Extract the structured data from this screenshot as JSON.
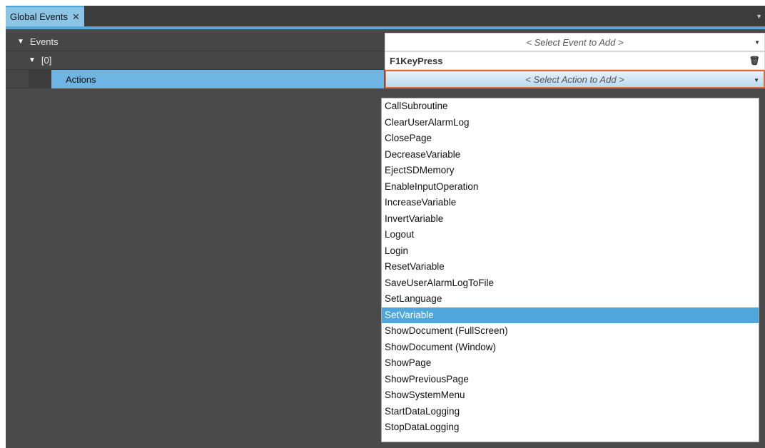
{
  "tab": {
    "title": "Global Events",
    "close": "✕",
    "menu": "▼"
  },
  "tree": {
    "events_label": "Events",
    "event_select_placeholder": "< Select Event to Add >",
    "index_label": "[0]",
    "event_value": "F1KeyPress",
    "actions_label": "Actions",
    "action_select_placeholder": "< Select Action to Add >"
  },
  "dropdown": {
    "selected": "SetVariable",
    "options": [
      "CallSubroutine",
      "ClearUserAlarmLog",
      "ClosePage",
      "DecreaseVariable",
      "EjectSDMemory",
      "EnableInputOperation",
      "IncreaseVariable",
      "InvertVariable",
      "Logout",
      "Login",
      "ResetVariable",
      "SaveUserAlarmLogToFile",
      "SetLanguage",
      "SetVariable",
      "ShowDocument (FullScreen)",
      "ShowDocument (Window)",
      "ShowPage",
      "ShowPreviousPage",
      "ShowSystemMenu",
      "StartDataLogging",
      "StopDataLogging"
    ]
  },
  "colors": {
    "accent": "#4ea6dc",
    "focus_border": "#e06a3a"
  }
}
